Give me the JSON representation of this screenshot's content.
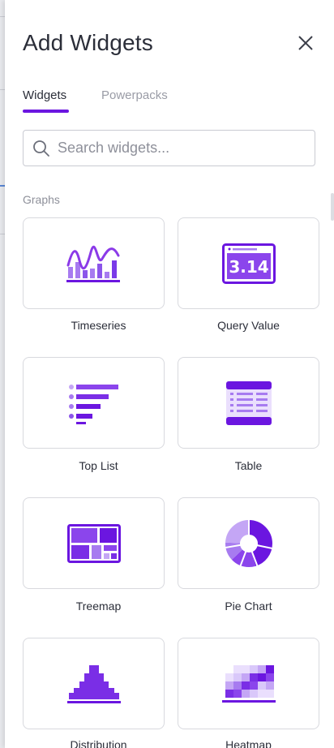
{
  "panel": {
    "title": "Add Widgets",
    "close_label": "close"
  },
  "tabs": [
    {
      "label": "Widgets",
      "active": true
    },
    {
      "label": "Powerpacks",
      "active": false
    }
  ],
  "search": {
    "placeholder": "Search widgets...",
    "value": ""
  },
  "section": {
    "label": "Graphs"
  },
  "widgets": [
    {
      "label": "Timeseries",
      "icon": "timeseries-icon"
    },
    {
      "label": "Query Value",
      "icon": "query-value-icon",
      "icon_text": "3.14"
    },
    {
      "label": "Top List",
      "icon": "top-list-icon"
    },
    {
      "label": "Table",
      "icon": "table-icon"
    },
    {
      "label": "Treemap",
      "icon": "treemap-icon"
    },
    {
      "label": "Pie Chart",
      "icon": "pie-chart-icon"
    },
    {
      "label": "Distribution",
      "icon": "distribution-icon"
    },
    {
      "label": "Heatmap",
      "icon": "heatmap-icon"
    }
  ],
  "colors": {
    "accent": "#6b16e0",
    "accent_light": "#a77bf0",
    "accent_pale": "#d9c8fa"
  }
}
